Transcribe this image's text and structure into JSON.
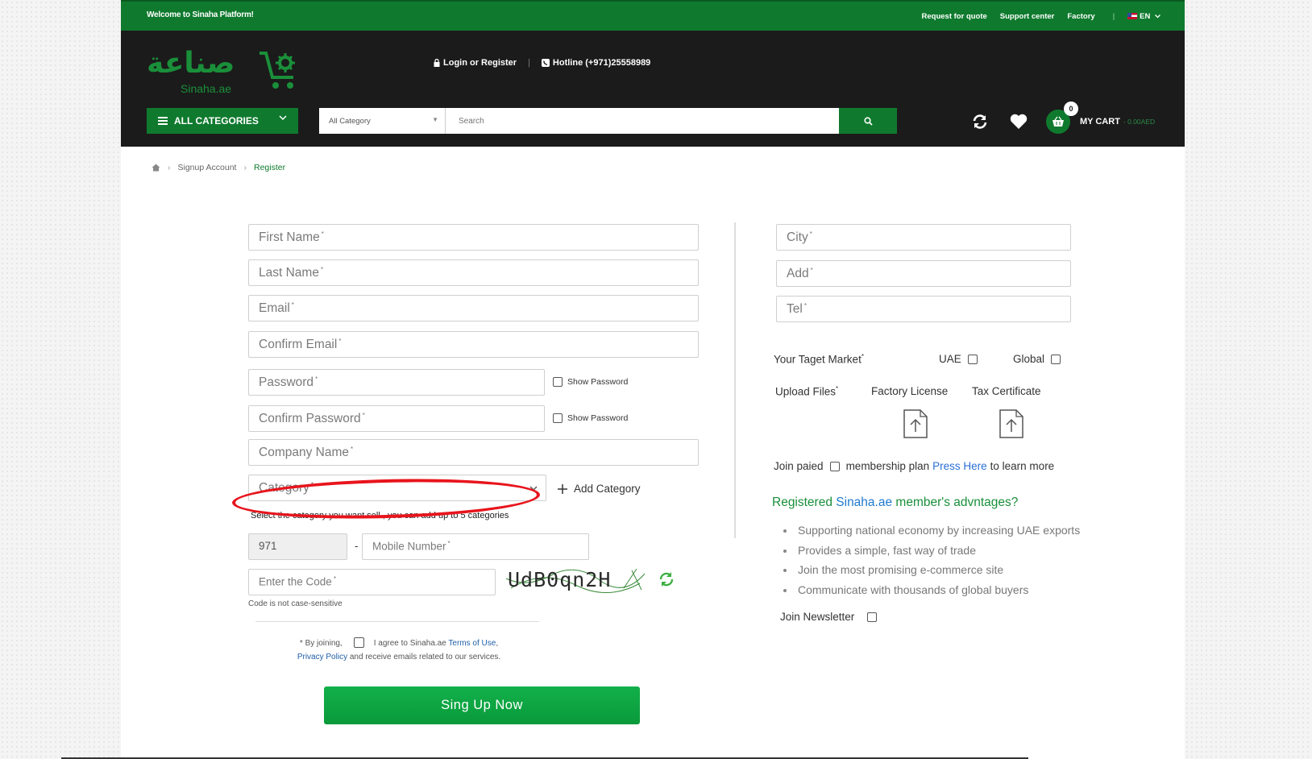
{
  "topbar": {
    "welcome": "Welcome to Sinaha Platform!",
    "links": [
      "Request for quote",
      "Support center",
      "Factory"
    ],
    "separator": "|",
    "language": "EN"
  },
  "header": {
    "logo_arabic": "صناعة",
    "logo_english": "Sinaha.ae",
    "login": "Login or Register",
    "divider": "|",
    "hotline": "Hotline (+971)25558989",
    "all_categories": "ALL CATEGORIES",
    "search_category": "All Category",
    "search_placeholder": "Search",
    "cart_count": "0",
    "cart_label": "MY CART",
    "cart_total": "- 0.00AED"
  },
  "breadcrumb": {
    "items": [
      "Signup Account",
      "Register"
    ]
  },
  "form": {
    "first_name": "First Name",
    "last_name": "Last Name",
    "email": "Email",
    "confirm_email": "Confirm Email",
    "password": "Password",
    "confirm_password": "Confirm Password",
    "show_password": "Show Password",
    "company_name": "Company Name",
    "category": "Category",
    "add_category": "Add Category",
    "category_hint": "Select the category you want sell , you can add up to 5 categories",
    "country_code": "971",
    "dash": "-",
    "mobile_number": "Mobile Number",
    "enter_code": "Enter the Code",
    "captcha_text": "UdB0qn2H",
    "code_hint": "Code is not case-sensitive",
    "required_mark": "*",
    "agree_prefix": "* By joining,",
    "agree_text": "I agree to Sinaha.ae",
    "terms": "Terms of Use",
    "privacy": "Privacy Policy",
    "agree_suffix": "and receive emails related to our services.",
    "submit": "Sing Up Now"
  },
  "right": {
    "city": "City",
    "add": "Add",
    "tel": "Tel",
    "target_market": "Your Taget Market",
    "uae": "UAE",
    "global": "Global",
    "upload_files": "Upload Files",
    "factory_license": "Factory License",
    "tax_certificate": "Tax Certificate",
    "join_paid": "Join paied",
    "membership_plan": "membership plan",
    "press_here": "Press Here",
    "learn_more": "to learn more",
    "adv_title_prefix": "Registered",
    "adv_title_site": "Sinaha.ae",
    "adv_title_suffix": "member's advntages?",
    "advantages": [
      "Supporting national economy by increasing UAE exports",
      "Provides a simple, fast way of trade",
      "Join the most promising e-commerce site",
      "Communicate with thousands of global buyers"
    ],
    "join_newsletter": "Join Newsletter"
  },
  "colors": {
    "brand_green": "#0f7a2e",
    "header_dark": "#1b1b1b",
    "button_green": "#12b04a",
    "annotation_red": "#e8141c",
    "link_blue": "#1f5fa8"
  }
}
